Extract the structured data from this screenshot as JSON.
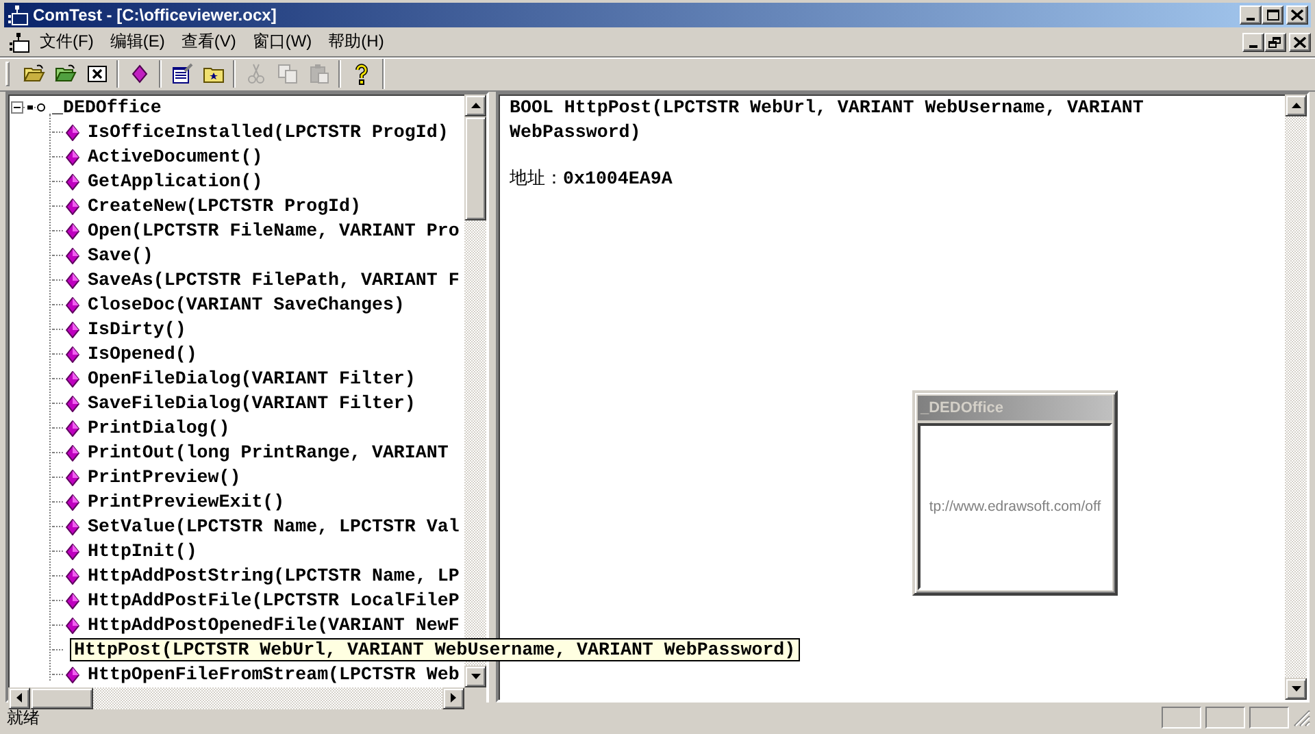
{
  "window": {
    "title": "ComTest - [C:\\officeviewer.ocx]"
  },
  "menu": [
    {
      "label": "文件(F)"
    },
    {
      "label": "编辑(E)"
    },
    {
      "label": "查看(V)"
    },
    {
      "label": "窗口(W)"
    },
    {
      "label": "帮助(H)"
    }
  ],
  "toolbar": [
    {
      "kind": "open",
      "disabled": false
    },
    {
      "kind": "open-green",
      "disabled": false
    },
    {
      "kind": "close",
      "disabled": false
    },
    {
      "kind": "separator"
    },
    {
      "kind": "method",
      "disabled": false
    },
    {
      "kind": "separator"
    },
    {
      "kind": "properties",
      "disabled": false
    },
    {
      "kind": "folder-star",
      "disabled": false
    },
    {
      "kind": "separator"
    },
    {
      "kind": "cut",
      "disabled": true
    },
    {
      "kind": "copy",
      "disabled": true
    },
    {
      "kind": "paste",
      "disabled": true
    },
    {
      "kind": "separator"
    },
    {
      "kind": "help",
      "disabled": false
    }
  ],
  "tree": {
    "label": "_DEDOffice",
    "expanded": true,
    "children": [
      {
        "label": "IsOfficeInstalled(LPCTSTR ProgId)",
        "hovered": false
      },
      {
        "label": "ActiveDocument()",
        "hovered": false
      },
      {
        "label": "GetApplication()",
        "hovered": false
      },
      {
        "label": "CreateNew(LPCTSTR ProgId)",
        "hovered": false
      },
      {
        "label": "Open(LPCTSTR FileName, VARIANT Pro",
        "hovered": false
      },
      {
        "label": "Save()",
        "hovered": false
      },
      {
        "label": "SaveAs(LPCTSTR FilePath, VARIANT F",
        "hovered": false
      },
      {
        "label": "CloseDoc(VARIANT SaveChanges)",
        "hovered": false
      },
      {
        "label": "IsDirty()",
        "hovered": false
      },
      {
        "label": "IsOpened()",
        "hovered": false
      },
      {
        "label": "OpenFileDialog(VARIANT Filter)",
        "hovered": false
      },
      {
        "label": "SaveFileDialog(VARIANT Filter)",
        "hovered": false
      },
      {
        "label": "PrintDialog()",
        "hovered": false
      },
      {
        "label": "PrintOut(long PrintRange, VARIANT",
        "hovered": false
      },
      {
        "label": "PrintPreview()",
        "hovered": false
      },
      {
        "label": "PrintPreviewExit()",
        "hovered": false
      },
      {
        "label": "SetValue(LPCTSTR Name, LPCTSTR Val",
        "hovered": false
      },
      {
        "label": "HttpInit()",
        "hovered": false
      },
      {
        "label": "HttpAddPostString(LPCTSTR Name, LP",
        "hovered": false
      },
      {
        "label": "HttpAddPostFile(LPCTSTR LocalFileP",
        "hovered": false
      },
      {
        "label": "HttpAddPostOpenedFile(VARIANT NewF",
        "hovered": false
      },
      {
        "label": "HttpPost(LPCTSTR WebUrl, VARIANT WebUsername, VARIANT WebPassword)",
        "hovered": true
      },
      {
        "label": "HttpOpenFileFromStream(LPCTSTR Web",
        "hovered": false
      }
    ]
  },
  "detail": {
    "signature": "BOOL HttpPost(LPCTSTR WebUrl, VARIANT WebUsername, VARIANT WebPassword)",
    "address_label": "地址：",
    "address": "0x1004EA9A"
  },
  "control_window": {
    "title": "_DEDOffice",
    "text": "tp://www.edrawsoft.com/off"
  },
  "status_bar": {
    "text": "就绪"
  }
}
